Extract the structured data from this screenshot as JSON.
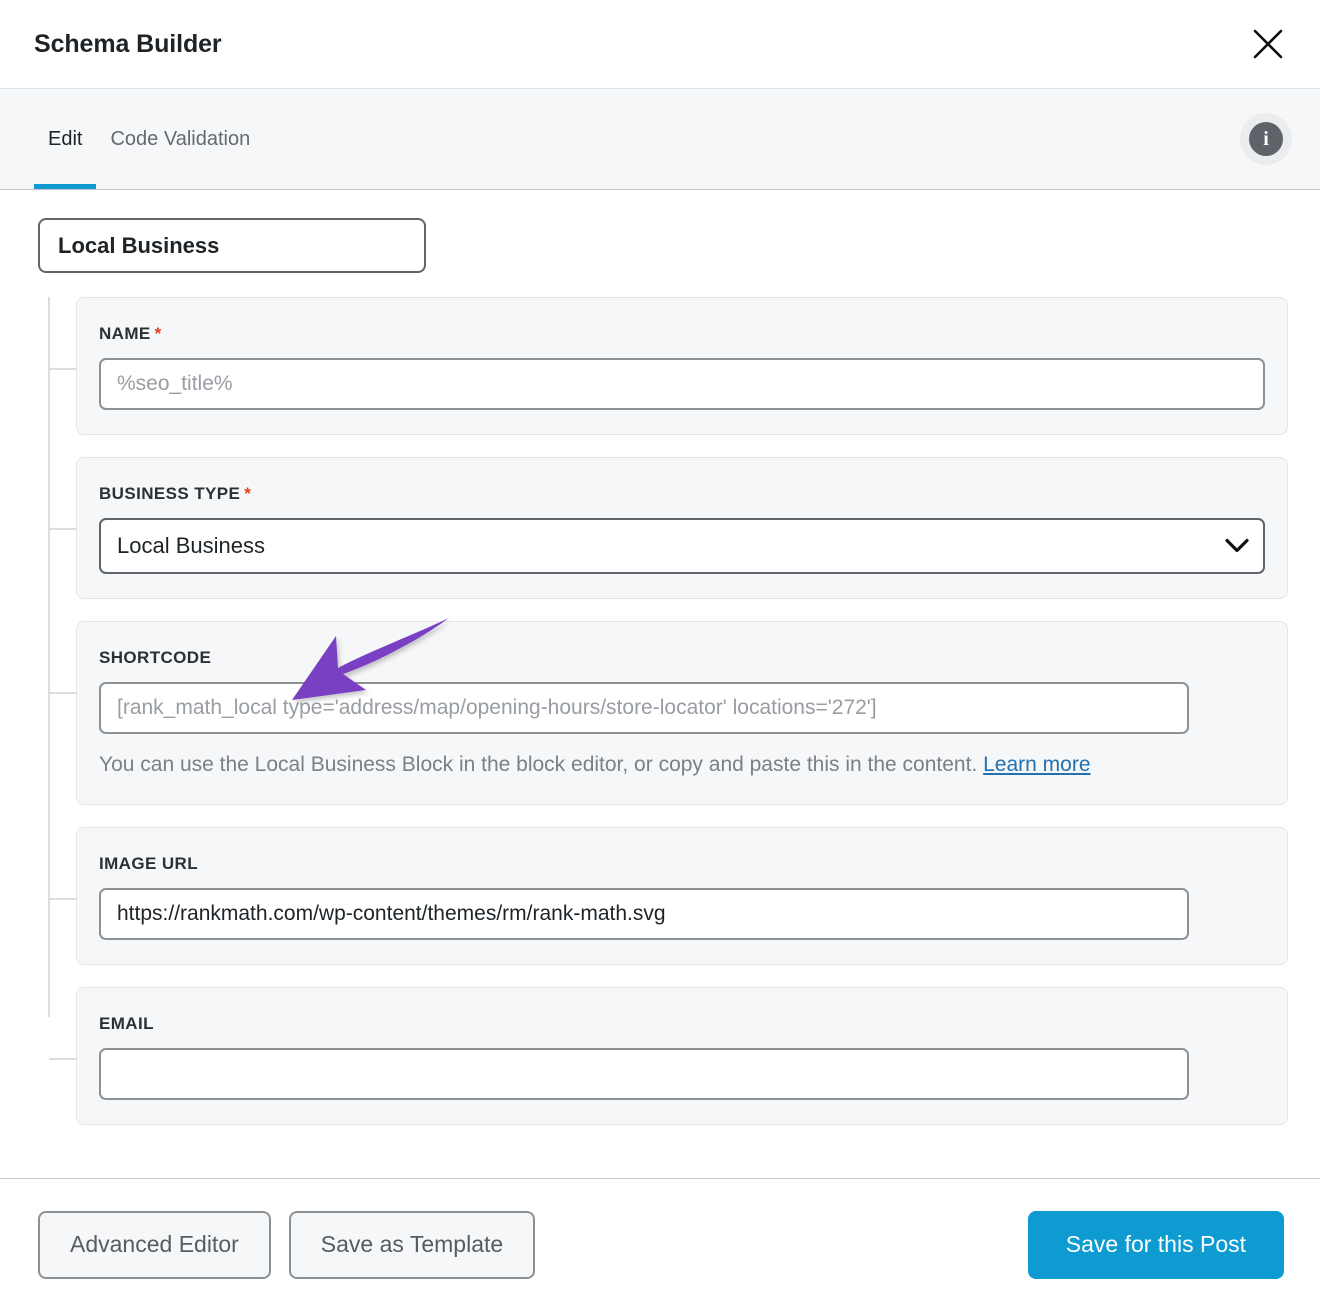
{
  "colors": {
    "accent": "#0d9bd1",
    "required": "#e2401c",
    "link": "#2271b1",
    "annotation_arrow": "#7a3fc4",
    "group_background": "#f6f7f8",
    "panel_background": "#ffffff"
  },
  "header": {
    "title": "Schema Builder",
    "close_icon": "close-icon"
  },
  "tabs": {
    "items": [
      {
        "label": "Edit",
        "active": true
      },
      {
        "label": "Code Validation",
        "active": false
      }
    ],
    "info_icon": "info-icon",
    "info_glyph": "i"
  },
  "schema": {
    "root_label": "Local Business",
    "groups": [
      {
        "label": "NAME",
        "required": true,
        "required_marker": "*",
        "input": {
          "type": "text",
          "value": "",
          "placeholder": "%seo_title%"
        }
      },
      {
        "label": "BUSINESS TYPE",
        "required": true,
        "required_marker": "*",
        "select": {
          "value": "Local Business",
          "chevron_icon": "chevron-down-icon"
        }
      },
      {
        "label": "SHORTCODE",
        "required": false,
        "input": {
          "type": "text",
          "value": "",
          "placeholder": "[rank_math_local type='address/map/opening-hours/store-locator' locations='272']"
        },
        "help": {
          "text_before": "You can use the Local Business Block in the block editor, or copy and paste this in the content. ",
          "link_label": "Learn more"
        }
      },
      {
        "label": "IMAGE URL",
        "required": false,
        "input": {
          "type": "text",
          "value": "https://rankmath.com/wp-content/themes/rm/rank-math.svg",
          "placeholder": ""
        }
      },
      {
        "label": "EMAIL",
        "required": false,
        "input": {
          "type": "text",
          "value": "",
          "placeholder": ""
        }
      }
    ]
  },
  "annotation": {
    "shape": "curved-arrow-pointing-down-left",
    "target": "SHORTCODE"
  },
  "footer": {
    "advanced_editor_label": "Advanced Editor",
    "save_as_template_label": "Save as Template",
    "save_for_post_label": "Save for this Post"
  }
}
